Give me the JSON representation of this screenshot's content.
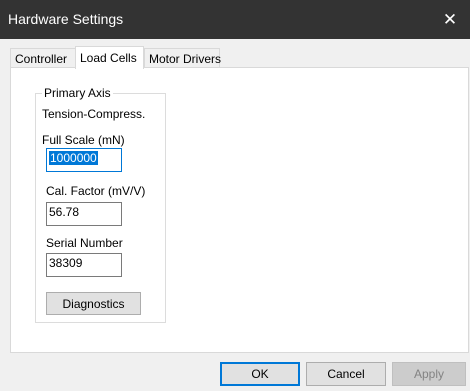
{
  "window": {
    "title": "Hardware Settings",
    "close_glyph": "✕"
  },
  "tabs": [
    {
      "label": "Controller",
      "active": false
    },
    {
      "label": "Load Cells",
      "active": true
    },
    {
      "label": "Motor Drivers",
      "active": false
    }
  ],
  "group": {
    "title": "Primary Axis",
    "mode": "Tension-Compress.",
    "full_scale": {
      "label": "Full Scale (mN)",
      "value": "1000000"
    },
    "cal_factor": {
      "label": "Cal. Factor (mV/V)",
      "value": "56.78"
    },
    "serial": {
      "label": "Serial Number",
      "value": "38309"
    },
    "diagnostics_label": "Diagnostics"
  },
  "buttons": {
    "ok": "OK",
    "cancel": "Cancel",
    "apply": "Apply"
  },
  "colors": {
    "titlebar": "#333333",
    "accent": "#0078d7",
    "panel": "#ffffff",
    "dialog": "#f0f0f0"
  }
}
